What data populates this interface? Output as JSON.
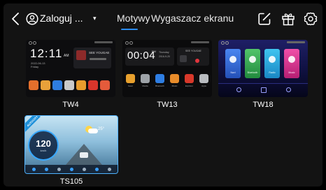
{
  "header": {
    "user_label": "Zaloguj ...",
    "user_caret": "▾",
    "tabs": [
      {
        "label": "Motywy",
        "active": true
      },
      {
        "label": "Wygaszacz ekranu",
        "active": false
      }
    ],
    "accent_color": "#2b8cf0"
  },
  "icons": [
    "back-icon",
    "user-circle-icon",
    "edit-icon",
    "gift-icon",
    "settings-gear-icon"
  ],
  "themes": [
    {
      "name": "TW4",
      "preview": {
        "time": "12:11",
        "ampm": "AM",
        "date": "2022-06-13",
        "weekday": "Friday",
        "music_title": "SEE YOUGAE"
      }
    },
    {
      "name": "TW13",
      "preview": {
        "time": "00:04",
        "suffix": "PM",
        "weekday": "Thursday",
        "date": "2016-9-20",
        "music_title": "SEE YOUGAE",
        "apps": [
          "Gear",
          "Media",
          "Bluetooth",
          "Music",
          "Explorer",
          "Apps"
        ]
      }
    },
    {
      "name": "TW18",
      "preview": {
        "apps": [
          "Navi",
          "Bluetooth",
          "Radio",
          "Music"
        ]
      }
    },
    {
      "name": "TS105",
      "preview": {
        "speed": "120",
        "speed_unit": "km/h",
        "temperature": "25°",
        "brand": "AUTOCITY"
      }
    }
  ]
}
